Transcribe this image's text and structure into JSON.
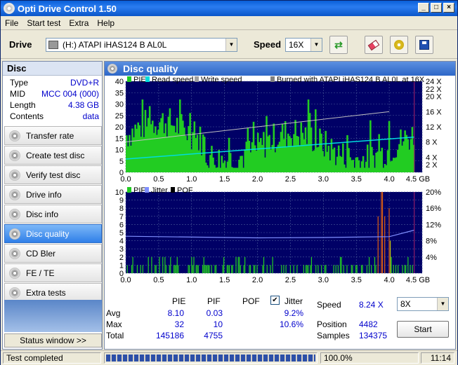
{
  "window": {
    "title": "Opti Drive Control 1.50"
  },
  "menu": [
    "File",
    "Start test",
    "Extra",
    "Help"
  ],
  "toolbar": {
    "drive_label": "Drive",
    "drive_value": "(H:)   ATAPI iHAS124   B AL0L",
    "speed_label": "Speed",
    "speed_value": "16X"
  },
  "disc": {
    "header": "Disc",
    "rows": [
      {
        "k": "Type",
        "v": "DVD+R"
      },
      {
        "k": "MID",
        "v": "MCC 004 (000)"
      },
      {
        "k": "Length",
        "v": "4.38 GB"
      },
      {
        "k": "Contents",
        "v": "data"
      }
    ]
  },
  "nav": [
    "Transfer rate",
    "Create test disc",
    "Verify test disc",
    "Drive info",
    "Disc info",
    "Disc quality",
    "CD Bler",
    "FE / TE",
    "Extra tests"
  ],
  "nav_selected": "Disc quality",
  "status_window": "Status window >>",
  "panel_title": "Disc quality",
  "chart_data": [
    {
      "type": "bar",
      "legend": [
        "PIE",
        "Read speed",
        "Write speed",
        "Burned with ATAPI iHAS124   B AL0L at 16X"
      ],
      "x_ticks": [
        "0.0",
        "0.5",
        "1.0",
        "1.5",
        "2.0",
        "2.5",
        "3.0",
        "3.5",
        "4.0",
        "4.5 GB"
      ],
      "xlim": [
        0,
        4.5
      ],
      "y_ticks": [
        "0",
        "5",
        "10",
        "15",
        "20",
        "25",
        "30",
        "35",
        "40"
      ],
      "ylim": [
        0,
        40
      ],
      "y2_ticks": [
        "2 X",
        "4 X",
        "8 X",
        "12 X",
        "16 X",
        "20 X",
        "22 X",
        "24 X"
      ],
      "y2lim": [
        0,
        24
      ],
      "read_speed": {
        "x": [
          0,
          4.38
        ],
        "y": [
          3.5,
          9.3
        ]
      },
      "write_speed": {
        "x": [
          0,
          4.0
        ],
        "y": [
          8,
          16
        ]
      }
    },
    {
      "type": "bar",
      "legend": [
        "PIF",
        "Jitter",
        "POF"
      ],
      "x_ticks": [
        "0.0",
        "0.5",
        "1.0",
        "1.5",
        "2.0",
        "2.5",
        "3.0",
        "3.5",
        "4.0",
        "4.5 GB"
      ],
      "xlim": [
        0,
        4.5
      ],
      "y_ticks": [
        "0",
        "1",
        "2",
        "3",
        "4",
        "5",
        "6",
        "7",
        "8",
        "9",
        "10"
      ],
      "ylim": [
        0,
        10
      ],
      "y2_ticks": [
        "4%",
        "8%",
        "12%",
        "16%",
        "20%"
      ],
      "y2lim": [
        0,
        20
      ],
      "jitter": {
        "x": [
          0,
          1.0,
          2.0,
          3.0,
          4.0,
          4.38
        ],
        "y": [
          9.1,
          8.9,
          8.7,
          8.8,
          9.0,
          10.6
        ]
      }
    }
  ],
  "stats": {
    "col_pie": "PIE",
    "col_pif": "PIF",
    "col_pof": "POF",
    "col_jitter": "Jitter",
    "jitter_checked": "✔",
    "row_avg": "Avg",
    "row_max": "Max",
    "row_total": "Total",
    "avg_pie": "8.10",
    "avg_pif": "0.03",
    "avg_jitter": "9.2%",
    "max_pie": "32",
    "max_pif": "10",
    "max_jitter": "10.6%",
    "total_pie": "145186",
    "total_pif": "4755",
    "speed_label": "Speed",
    "speed_value": "8.24 X",
    "speed_select": "8X",
    "position_label": "Position",
    "position_value": "4482",
    "samples_label": "Samples",
    "samples_value": "134375",
    "start": "Start"
  },
  "statusbar": {
    "text": "Test completed",
    "progress": 1.0,
    "progress_text": "100.0%",
    "time": "11:14"
  }
}
